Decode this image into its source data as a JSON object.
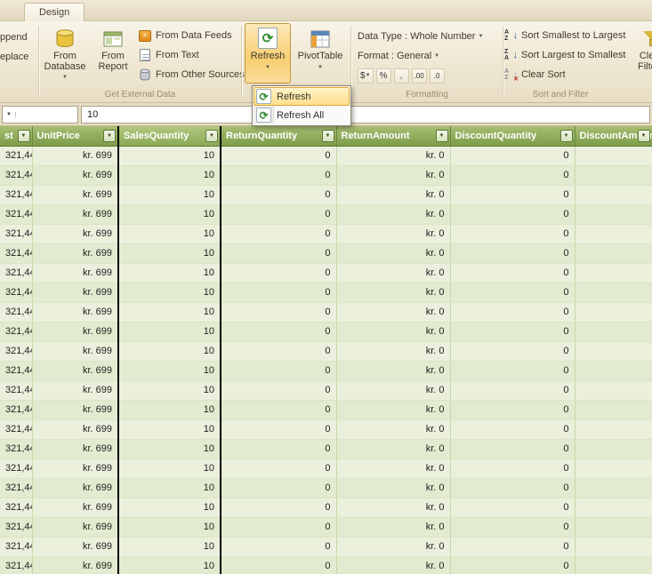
{
  "window": {
    "tab": "Design"
  },
  "ribbon": {
    "clipboard": {
      "append_label": "ppend",
      "replace_label": "eplace"
    },
    "external": {
      "from_database": "From Database",
      "from_report": "From Report",
      "from_data_feeds": "From Data Feeds",
      "from_text": "From Text",
      "from_other_sources": "From Other Sources",
      "group_label": "Get External Data"
    },
    "refresh_label": "Refresh",
    "pivottable_label": "PivotTable",
    "formatting": {
      "data_type_label": "Data Type : Whole Number",
      "format_label": "Format : General",
      "group_label": "Formatting"
    },
    "sort_filter": {
      "sort_asc_label": "Sort Smallest to Largest",
      "sort_desc_label": "Sort Largest to Smallest",
      "clear_sort_label": "Clear Sort",
      "clear_filters_line1": "Clear",
      "clear_filters_line2": "Filters",
      "group_label": "Sort and Filter"
    }
  },
  "refresh_menu": {
    "items": [
      "Refresh",
      "Refresh All"
    ]
  },
  "formula_bar": {
    "value": "10"
  },
  "table": {
    "columns": [
      {
        "label": "st",
        "selected": false
      },
      {
        "label": "UnitPrice",
        "selected": false
      },
      {
        "label": "SalesQuantity",
        "selected": true
      },
      {
        "label": "ReturnQuantity",
        "selected": false
      },
      {
        "label": "ReturnAmount",
        "selected": false
      },
      {
        "label": "DiscountQuantity",
        "selected": false
      },
      {
        "label": "DiscountAmount",
        "selected": false
      }
    ],
    "row_values": [
      "321,44",
      "kr. 699",
      "10",
      "0",
      "kr. 0",
      "0",
      ""
    ],
    "row_count": 22
  },
  "icons": {
    "dropdown-arrow": "▼",
    "filter-arrow": "▼",
    "refresh-glyph": "⟳",
    "feed-glyph": "≡",
    "letter-a": "A",
    "letter-z": "Z",
    "arrow-down": "↓",
    "clear-x": "✕",
    "currency": "$",
    "percent": "%",
    "comma": ",",
    "increase-decimal": ".00",
    "decrease-decimal": ".0"
  },
  "colors": {
    "header_green": "#7E9C49",
    "selection_orange": "#FFE8A6",
    "ribbon_tan": "#EFE7D2"
  }
}
